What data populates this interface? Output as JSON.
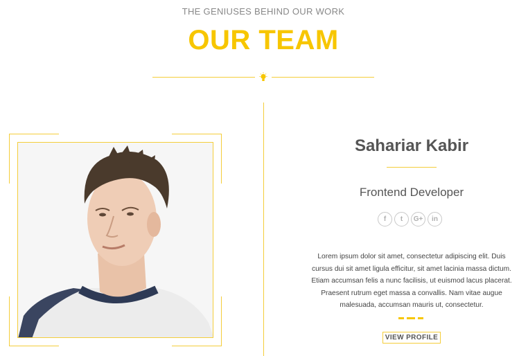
{
  "section": {
    "eyebrow": "THE GENIUSES BEHIND OUR WORK",
    "title": "OUR TEAM",
    "accent_color": "#f7c600"
  },
  "member": {
    "name": "Sahariar Kabir",
    "role": "Frontend Developer",
    "bio": "Lorem ipsum dolor sit amet, consectetur adipiscing elit. Duis cursus dui sit amet ligula efficitur, sit amet lacinia massa dictum. Etiam accumsan felis a nunc facilisis, ut euismod lacus placerat. Praesent rutrum eget massa a convallis. Nam vitae augue malesuada, accumsan mauris ut, consectetur.",
    "cta": "VIEW PROFILE",
    "socials": [
      {
        "icon": "facebook-icon",
        "glyph": "f"
      },
      {
        "icon": "twitter-icon",
        "glyph": "t"
      },
      {
        "icon": "google-plus-icon",
        "glyph": "G+"
      },
      {
        "icon": "linkedin-icon",
        "glyph": "in"
      }
    ]
  }
}
